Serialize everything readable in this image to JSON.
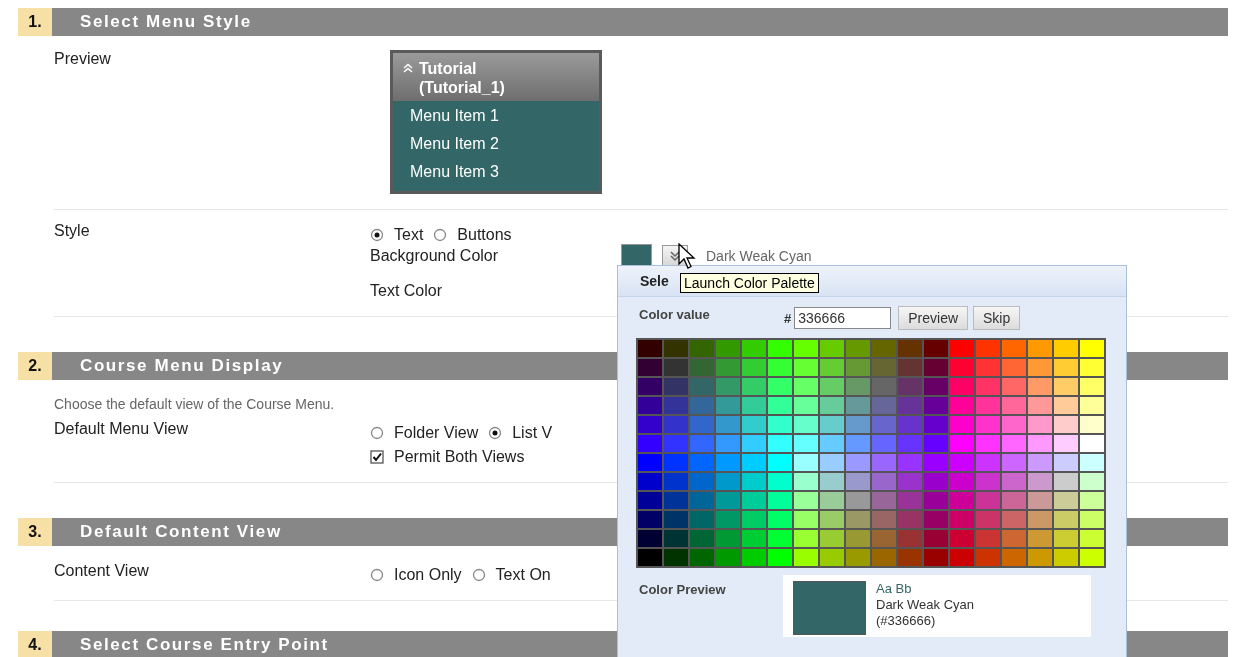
{
  "sections": [
    {
      "number": "1.",
      "title": "Select Menu Style",
      "fields": [
        {
          "kind": "preview",
          "label": "Preview",
          "menu_title": "Tutorial (Tutorial_1)",
          "menu_items": [
            "Menu Item 1",
            "Menu Item 2",
            "Menu Item 3"
          ]
        },
        {
          "kind": "style",
          "label": "Style",
          "options": [
            {
              "label": "Text",
              "selected": true
            },
            {
              "label": "Buttons",
              "selected": false
            }
          ],
          "colors": [
            {
              "label": "Background Color",
              "color": "#336666",
              "color_name": "Dark Weak Cyan"
            },
            {
              "label": "Text Color"
            }
          ]
        }
      ]
    },
    {
      "number": "2.",
      "title": "Course Menu Display",
      "description": "Choose the default view of the Course Menu.",
      "fields": [
        {
          "kind": "choice",
          "label": "Default Menu View",
          "options": [
            {
              "label": "Folder View",
              "selected": false
            },
            {
              "label": "List V",
              "selected": true
            }
          ],
          "checkbox": {
            "label": "Permit Both Views",
            "checked": true
          }
        }
      ]
    },
    {
      "number": "3.",
      "title": "Default Content View",
      "fields": [
        {
          "kind": "choice",
          "label": "Content View",
          "options": [
            {
              "label": "Icon Only",
              "selected": false
            },
            {
              "label": "Text On",
              "selected": false
            }
          ]
        }
      ]
    },
    {
      "number": "4.",
      "title": "Select Course Entry Point"
    }
  ],
  "color_picker": {
    "title": "Sele",
    "value_label": "Color value",
    "hash": "#",
    "value": "336666",
    "buttons": [
      "Preview",
      "Skip"
    ],
    "palette": [
      [
        {
          "color": "#330000"
        },
        {
          "color": "#333300"
        },
        {
          "color": "#336600"
        },
        {
          "color": "#339900"
        },
        {
          "color": "#33cc00"
        },
        {
          "color": "#33ff00"
        },
        {
          "color": "#66ff00"
        },
        {
          "color": "#66cc00"
        },
        {
          "color": "#669900"
        },
        {
          "color": "#666600"
        },
        {
          "color": "#663300"
        },
        {
          "color": "#660000"
        },
        {
          "color": "#ff0000"
        },
        {
          "color": "#ff3300"
        },
        {
          "color": "#ff6600"
        },
        {
          "color": "#ff9900"
        },
        {
          "color": "#ffcc00"
        },
        {
          "color": "#ffff00"
        }
      ],
      [
        {
          "color": "#330033"
        },
        {
          "color": "#333333"
        },
        {
          "color": "#336633"
        },
        {
          "color": "#339933"
        },
        {
          "color": "#33cc33"
        },
        {
          "color": "#33ff33"
        },
        {
          "color": "#66ff33"
        },
        {
          "color": "#66cc33"
        },
        {
          "color": "#669933"
        },
        {
          "color": "#666633"
        },
        {
          "color": "#663333"
        },
        {
          "color": "#660033"
        },
        {
          "color": "#ff0033"
        },
        {
          "color": "#ff3333"
        },
        {
          "color": "#ff6633"
        },
        {
          "color": "#ff9933"
        },
        {
          "color": "#ffcc33"
        },
        {
          "color": "#ffff33"
        }
      ],
      [
        {
          "color": "#330066"
        },
        {
          "color": "#333366"
        },
        {
          "color": "#336666"
        },
        {
          "color": "#339966"
        },
        {
          "color": "#33cc66"
        },
        {
          "color": "#33ff66"
        },
        {
          "color": "#66ff66"
        },
        {
          "color": "#66cc66"
        },
        {
          "color": "#669966"
        },
        {
          "color": "#666666"
        },
        {
          "color": "#663366"
        },
        {
          "color": "#660066"
        },
        {
          "color": "#ff0066"
        },
        {
          "color": "#ff3366"
        },
        {
          "color": "#ff6666"
        },
        {
          "color": "#ff9966"
        },
        {
          "color": "#ffcc66"
        },
        {
          "color": "#ffff66"
        }
      ],
      [
        {
          "color": "#330099"
        },
        {
          "color": "#333399"
        },
        {
          "color": "#336699"
        },
        {
          "color": "#339999"
        },
        {
          "color": "#33cc99"
        },
        {
          "color": "#33ff99"
        },
        {
          "color": "#66ff99"
        },
        {
          "color": "#66cc99"
        },
        {
          "color": "#669999"
        },
        {
          "color": "#666699"
        },
        {
          "color": "#663399"
        },
        {
          "color": "#660099"
        },
        {
          "color": "#ff0099"
        },
        {
          "color": "#ff3399"
        },
        {
          "color": "#ff6699"
        },
        {
          "color": "#ff9999"
        },
        {
          "color": "#ffcc99"
        },
        {
          "color": "#ffff99"
        }
      ],
      [
        {
          "color": "#3300cc"
        },
        {
          "color": "#3333cc"
        },
        {
          "color": "#3366cc"
        },
        {
          "color": "#3399cc"
        },
        {
          "color": "#33cccc"
        },
        {
          "color": "#33ffcc"
        },
        {
          "color": "#66ffcc"
        },
        {
          "color": "#66cccc"
        },
        {
          "color": "#6699cc"
        },
        {
          "color": "#6666cc"
        },
        {
          "color": "#6633cc"
        },
        {
          "color": "#6600cc"
        },
        {
          "color": "#ff00cc"
        },
        {
          "color": "#ff33cc"
        },
        {
          "color": "#ff66cc"
        },
        {
          "color": "#ff99cc"
        },
        {
          "color": "#ffcccc"
        },
        {
          "color": "#ffffcc"
        }
      ],
      [
        {
          "color": "#3300ff"
        },
        {
          "color": "#3333ff"
        },
        {
          "color": "#3366ff"
        },
        {
          "color": "#3399ff"
        },
        {
          "color": "#33ccff"
        },
        {
          "color": "#33ffff"
        },
        {
          "color": "#66ffff"
        },
        {
          "color": "#66ccff"
        },
        {
          "color": "#6699ff"
        },
        {
          "color": "#6666ff"
        },
        {
          "color": "#6633ff"
        },
        {
          "color": "#6600ff"
        },
        {
          "color": "#ff00ff"
        },
        {
          "color": "#ff33ff"
        },
        {
          "color": "#ff66ff"
        },
        {
          "color": "#ff99ff"
        },
        {
          "color": "#ffccff"
        },
        {
          "color": "#ffffff"
        }
      ],
      [
        {
          "color": "#0000ff"
        },
        {
          "color": "#0033ff"
        },
        {
          "color": "#0066ff"
        },
        {
          "color": "#0099ff"
        },
        {
          "color": "#00ccff"
        },
        {
          "color": "#00ffff"
        },
        {
          "color": "#99ffff"
        },
        {
          "color": "#99ccff"
        },
        {
          "color": "#9999ff"
        },
        {
          "color": "#9966ff"
        },
        {
          "color": "#9933ff"
        },
        {
          "color": "#9900ff"
        },
        {
          "color": "#cc00ff"
        },
        {
          "color": "#cc33ff"
        },
        {
          "color": "#cc66ff"
        },
        {
          "color": "#cc99ff"
        },
        {
          "color": "#ccccff"
        },
        {
          "color": "#ccffff"
        }
      ],
      [
        {
          "color": "#0000cc"
        },
        {
          "color": "#0033cc"
        },
        {
          "color": "#0066cc"
        },
        {
          "color": "#0099cc"
        },
        {
          "color": "#00cccc"
        },
        {
          "color": "#00ffcc"
        },
        {
          "color": "#99ffcc"
        },
        {
          "color": "#99cccc"
        },
        {
          "color": "#9999cc"
        },
        {
          "color": "#9966cc"
        },
        {
          "color": "#9933cc"
        },
        {
          "color": "#9900cc"
        },
        {
          "color": "#cc00cc"
        },
        {
          "color": "#cc33cc"
        },
        {
          "color": "#cc66cc"
        },
        {
          "color": "#cc99cc"
        },
        {
          "color": "#cccccc"
        },
        {
          "color": "#ccffcc"
        }
      ],
      [
        {
          "color": "#000099"
        },
        {
          "color": "#003399"
        },
        {
          "color": "#006699"
        },
        {
          "color": "#009999"
        },
        {
          "color": "#00cc99"
        },
        {
          "color": "#00ff99"
        },
        {
          "color": "#99ff99"
        },
        {
          "color": "#99cc99"
        },
        {
          "color": "#999999"
        },
        {
          "color": "#996699"
        },
        {
          "color": "#993399"
        },
        {
          "color": "#990099"
        },
        {
          "color": "#cc0099"
        },
        {
          "color": "#cc3399"
        },
        {
          "color": "#cc6699"
        },
        {
          "color": "#cc9999"
        },
        {
          "color": "#cccc99"
        },
        {
          "color": "#ccff99"
        }
      ],
      [
        {
          "color": "#000066"
        },
        {
          "color": "#003366"
        },
        {
          "color": "#006666"
        },
        {
          "color": "#009966"
        },
        {
          "color": "#00cc66"
        },
        {
          "color": "#00ff66"
        },
        {
          "color": "#99ff66"
        },
        {
          "color": "#99cc66"
        },
        {
          "color": "#999966"
        },
        {
          "color": "#996666"
        },
        {
          "color": "#993366"
        },
        {
          "color": "#990066"
        },
        {
          "color": "#cc0066"
        },
        {
          "color": "#cc3366"
        },
        {
          "color": "#cc6666"
        },
        {
          "color": "#cc9966"
        },
        {
          "color": "#cccc66"
        },
        {
          "color": "#ccff66"
        }
      ],
      [
        {
          "color": "#000033"
        },
        {
          "color": "#003333"
        },
        {
          "color": "#006633"
        },
        {
          "color": "#009933"
        },
        {
          "color": "#00cc33"
        },
        {
          "color": "#00ff33"
        },
        {
          "color": "#99ff33"
        },
        {
          "color": "#99cc33"
        },
        {
          "color": "#999933"
        },
        {
          "color": "#996633"
        },
        {
          "color": "#993333"
        },
        {
          "color": "#990033"
        },
        {
          "color": "#cc0033"
        },
        {
          "color": "#cc3333"
        },
        {
          "color": "#cc6633"
        },
        {
          "color": "#cc9933"
        },
        {
          "color": "#cccc33"
        },
        {
          "color": "#ccff33"
        }
      ],
      [
        {
          "color": "#000000"
        },
        {
          "color": "#003300"
        },
        {
          "color": "#006600"
        },
        {
          "color": "#009900"
        },
        {
          "color": "#00cc00"
        },
        {
          "color": "#00ff00"
        },
        {
          "color": "#99ff00"
        },
        {
          "color": "#99cc00"
        },
        {
          "color": "#999900"
        },
        {
          "color": "#996600"
        },
        {
          "color": "#993300"
        },
        {
          "color": "#990000"
        },
        {
          "color": "#cc0000"
        },
        {
          "color": "#cc3300"
        },
        {
          "color": "#cc6600"
        },
        {
          "color": "#cc9900"
        },
        {
          "color": "#cccc00"
        },
        {
          "color": "#ccff00"
        }
      ]
    ],
    "preview_label": "Color Preview",
    "preview_sample": "Aa Bb",
    "preview_name": "Dark Weak Cyan",
    "preview_code": "(#336666)",
    "preview_swatch": {
      "color": "#336666"
    }
  },
  "tooltip": "Launch Color Palette"
}
